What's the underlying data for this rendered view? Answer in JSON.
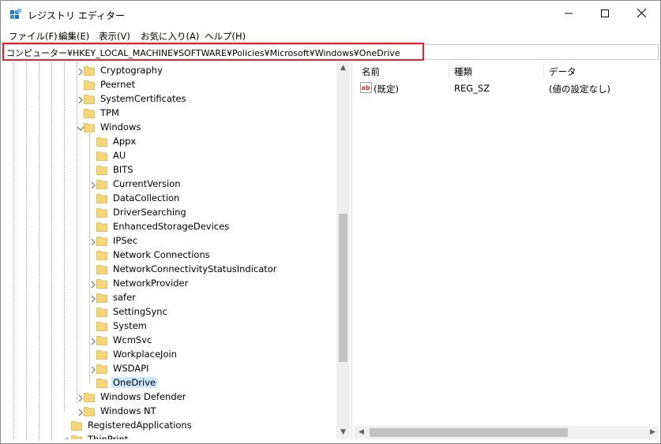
{
  "window": {
    "title": "レジストリ エディター",
    "controls": {
      "minimize": "minimize-icon",
      "maximize": "maximize-icon",
      "close": "close-icon"
    }
  },
  "menu": {
    "items": [
      {
        "label": "ファイル(F)"
      },
      {
        "label": "編集(E)"
      },
      {
        "label": "表示(V)"
      },
      {
        "label": "お気に入り(A)"
      },
      {
        "label": "ヘルプ(H)"
      }
    ]
  },
  "address": {
    "path": "コンピューター¥HKEY_LOCAL_MACHINE¥SOFTWARE¥Policies¥Microsoft¥Windows¥OneDrive",
    "highlight_color": "#e8232b"
  },
  "tree": {
    "nodes": [
      {
        "label": "Cryptography",
        "expandable": true
      },
      {
        "label": "Peernet",
        "expandable": false
      },
      {
        "label": "SystemCertificates",
        "expandable": true
      },
      {
        "label": "TPM",
        "expandable": false
      },
      {
        "label": "Windows",
        "expandable": true,
        "expanded": true
      },
      {
        "label": "Appx",
        "expandable": false
      },
      {
        "label": "AU",
        "expandable": false
      },
      {
        "label": "BITS",
        "expandable": false
      },
      {
        "label": "CurrentVersion",
        "expandable": true
      },
      {
        "label": "DataCollection",
        "expandable": false
      },
      {
        "label": "DriverSearching",
        "expandable": false
      },
      {
        "label": "EnhancedStorageDevices",
        "expandable": false
      },
      {
        "label": "IPSec",
        "expandable": true
      },
      {
        "label": "Network Connections",
        "expandable": false
      },
      {
        "label": "NetworkConnectivityStatusIndicator",
        "expandable": false
      },
      {
        "label": "NetworkProvider",
        "expandable": true
      },
      {
        "label": "safer",
        "expandable": true
      },
      {
        "label": "SettingSync",
        "expandable": false
      },
      {
        "label": "System",
        "expandable": false
      },
      {
        "label": "WcmSvc",
        "expandable": true
      },
      {
        "label": "WorkplaceJoin",
        "expandable": false
      },
      {
        "label": "WSDAPI",
        "expandable": true
      },
      {
        "label": "OneDrive",
        "expandable": false,
        "selected": true
      },
      {
        "label": "Windows Defender",
        "expandable": true
      },
      {
        "label": "Windows NT",
        "expandable": true
      },
      {
        "label": "RegisteredApplications",
        "expandable": false
      },
      {
        "label": "ThinPrint",
        "expandable": true
      }
    ],
    "folder_color": "#f5d67a",
    "selection_color": "#cce8ff"
  },
  "list": {
    "columns": [
      {
        "label": "名前"
      },
      {
        "label": "種類"
      },
      {
        "label": "データ"
      }
    ],
    "rows": [
      {
        "icon": "string-value-icon",
        "name": "(既定)",
        "type": "REG_SZ",
        "data": "(値の設定なし)"
      }
    ]
  }
}
